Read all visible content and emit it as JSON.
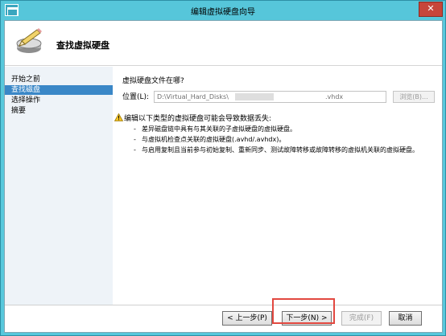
{
  "window": {
    "title": "编辑虚拟硬盘向导",
    "close_label": "✕"
  },
  "header": {
    "title": "查找虚拟硬盘"
  },
  "nav": {
    "items": [
      {
        "label": "开始之前",
        "active": false
      },
      {
        "label": "查找磁盘",
        "active": true
      },
      {
        "label": "选择操作",
        "active": false
      },
      {
        "label": "摘要",
        "active": false
      }
    ]
  },
  "content": {
    "question": "虚拟硬盘文件在哪?",
    "location_label": "位置(L):",
    "location_value": "D:\\Virtual_Hard_Disks\\",
    "location_suffix": ".vhdx",
    "browse_label": "浏览(B)...",
    "warning_intro": "编辑以下类型的虚拟硬盘可能会导致数据丢失:",
    "warning_bullets": [
      "差异磁盘链中具有与其关联的子虚拟硬盘的虚拟硬盘。",
      "与虚拟机检查点关联的虚拟硬盘(.avhd/.avhdx)。",
      "与启用复制且当前参与初始复制、重新同步、测试故障转移或故障转移的虚拟机关联的虚拟硬盘。"
    ]
  },
  "footer": {
    "prev_label": "< 上一步(P)",
    "next_label": "下一步(N) >",
    "finish_label": "完成(F)",
    "cancel_label": "取消"
  },
  "icons": {
    "app": "window-icon",
    "header": "pencil-disk-icon",
    "warning": "warning-icon"
  },
  "colors": {
    "title_bar": "#56c6da",
    "nav_active": "#3a87c7",
    "highlight": "#e24840"
  }
}
